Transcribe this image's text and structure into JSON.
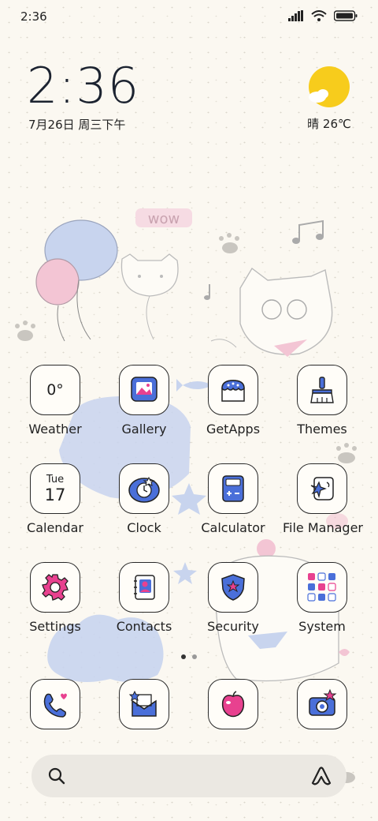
{
  "status_bar": {
    "time": "2:36"
  },
  "clock_widget": {
    "time": "2:36",
    "date": "7月26日 周三下午"
  },
  "weather_widget": {
    "condition_temp": "晴 26℃"
  },
  "apps": [
    {
      "label": "Weather",
      "icon": "weather-icon",
      "tile_text": "0°"
    },
    {
      "label": "Gallery",
      "icon": "gallery-icon"
    },
    {
      "label": "GetApps",
      "icon": "getapps-icon"
    },
    {
      "label": "Themes",
      "icon": "themes-icon"
    },
    {
      "label": "Calendar",
      "icon": "calendar-icon",
      "tile_day": "Tue",
      "tile_date": "17"
    },
    {
      "label": "Clock",
      "icon": "clock-icon"
    },
    {
      "label": "Calculator",
      "icon": "calculator-icon"
    },
    {
      "label": "File Manager",
      "icon": "file-manager-icon"
    },
    {
      "label": "Settings",
      "icon": "gear-icon"
    },
    {
      "label": "Contacts",
      "icon": "contacts-icon"
    },
    {
      "label": "Security",
      "icon": "shield-icon"
    },
    {
      "label": "System",
      "icon": "folder-icon"
    }
  ],
  "dock": [
    {
      "icon": "phone-icon"
    },
    {
      "icon": "messages-icon"
    },
    {
      "icon": "browser-icon"
    },
    {
      "icon": "camera-icon"
    }
  ],
  "page_indicator": {
    "pages": 2,
    "current": 2
  },
  "colors": {
    "accent_blue": "#4a6fd9",
    "accent_pink": "#e8418f",
    "sun": "#f7cc1c",
    "background": "#fbf8f1"
  }
}
